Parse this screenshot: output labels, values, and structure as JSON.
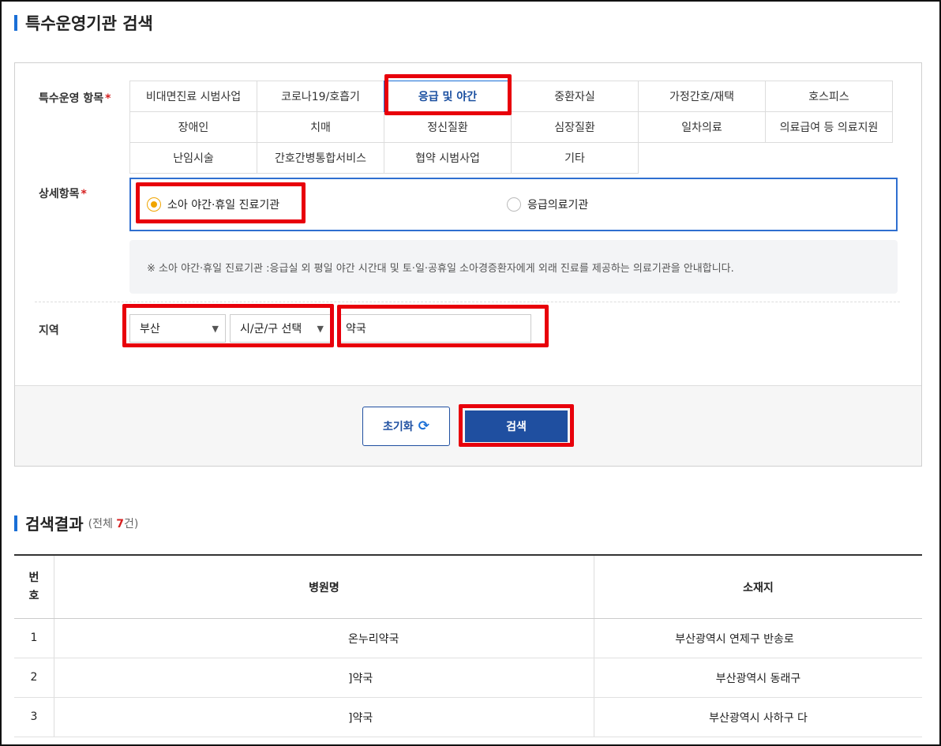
{
  "search_title": "특수운영기관 검색",
  "labels": {
    "category": "특수운영 항목",
    "required_mark": "*",
    "detail": "상세항목",
    "region": "지역"
  },
  "categories": [
    "비대면진료 시범사업",
    "코로나19/호흡기",
    "응급 및 야간",
    "중환자실",
    "가정간호/재택",
    "호스피스",
    "장애인",
    "치매",
    "정신질환",
    "심장질환",
    "일차의료",
    "의료급여 등 의료지원",
    "난임시술",
    "간호간병통합서비스",
    "협약 시범사업",
    "기타"
  ],
  "selected_category": "응급 및 야간",
  "detail_options": [
    {
      "label": "소아 야간·휴일 진료기관",
      "checked": true
    },
    {
      "label": "응급의료기관",
      "checked": false
    }
  ],
  "notice": "※ 소아 야간·휴일 진료기관 :응급실 외 평일 야간 시간대 및 토·일·공휴일 소아경증환자에게 외래 진료를 제공하는 의료기관을 안내합니다.",
  "region": {
    "city": "부산",
    "district": "시/군/구 선택",
    "keyword": "약국"
  },
  "buttons": {
    "reset": "초기화",
    "search": "검색"
  },
  "results": {
    "title": "검색결과",
    "count_prefix": "(전체 ",
    "count": "7",
    "count_suffix": "건)",
    "headers": {
      "no_line1": "번",
      "no_line2": "호",
      "name": "병원명",
      "address": "소재지"
    },
    "rows": [
      {
        "no": "1",
        "name": "온누리약국",
        "address": "부산광역시 연제구 반송로"
      },
      {
        "no": "2",
        "name": "]약국",
        "address": "부산광역시 동래구"
      },
      {
        "no": "3",
        "name": "]약국",
        "address": "부산광역시 사하구 다"
      }
    ]
  },
  "colors": {
    "primary": "#1f4fa0",
    "accent": "#1a6fd6",
    "highlight": "#e8000b",
    "required": "#d62020",
    "radio_on": "#f0a500"
  }
}
